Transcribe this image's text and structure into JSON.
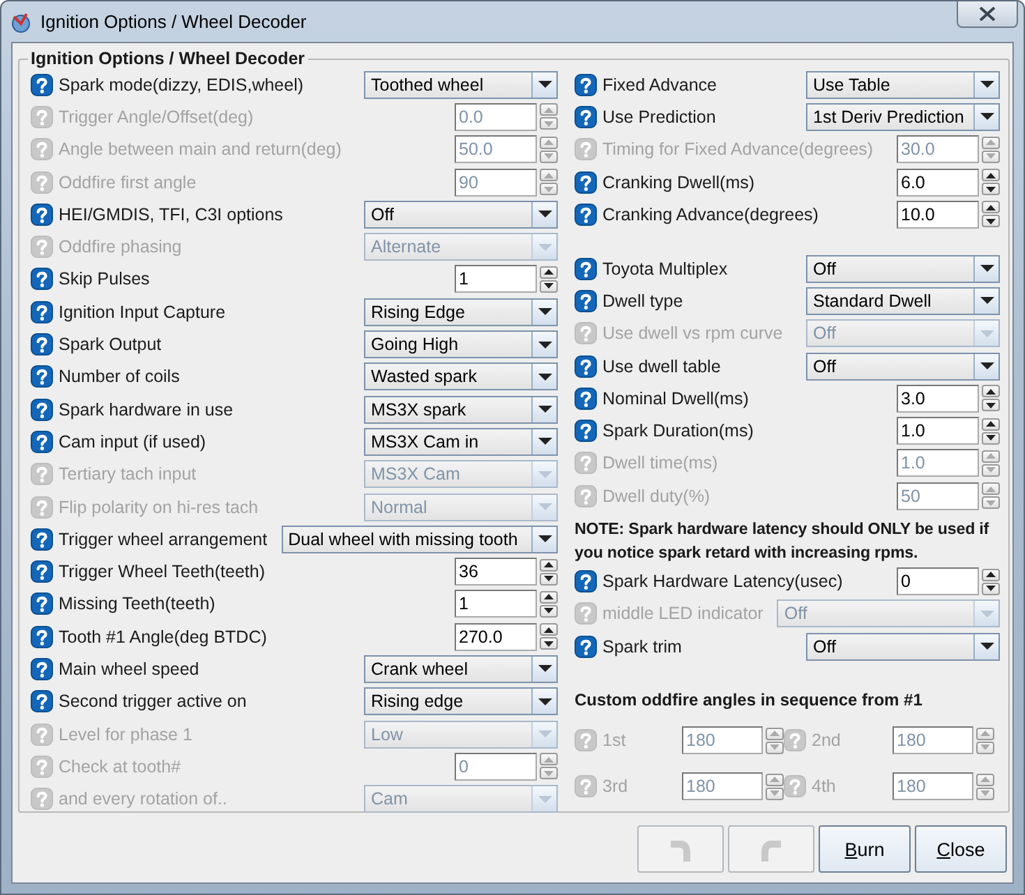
{
  "window": {
    "title": "Ignition Options / Wheel Decoder"
  },
  "panel": {
    "title": "Ignition Options / Wheel Decoder"
  },
  "left_rows": [
    {
      "label": "Spark mode(dizzy, EDIS,wheel)",
      "kind": "combo",
      "value": "Toothed wheel",
      "enabled": true
    },
    {
      "label": "Trigger Angle/Offset(deg)",
      "kind": "spin",
      "value": "0.0",
      "enabled": false
    },
    {
      "label": "Angle between main and return(deg)",
      "kind": "spin",
      "value": "50.0",
      "enabled": false
    },
    {
      "label": "Oddfire first angle",
      "kind": "spin",
      "value": "90",
      "enabled": false
    },
    {
      "label": "HEI/GMDIS, TFI, C3I options",
      "kind": "combo",
      "value": "Off",
      "enabled": true
    },
    {
      "label": "Oddfire phasing",
      "kind": "combo",
      "value": "Alternate",
      "enabled": false
    },
    {
      "label": "Skip Pulses",
      "kind": "spin",
      "value": "1",
      "enabled": true
    },
    {
      "label": "Ignition Input Capture",
      "kind": "combo",
      "value": "Rising Edge",
      "enabled": true
    },
    {
      "label": "Spark Output",
      "kind": "combo",
      "value": "Going High",
      "enabled": true
    },
    {
      "label": "Number of coils",
      "kind": "combo",
      "value": "Wasted spark",
      "enabled": true
    },
    {
      "label": "Spark hardware in use",
      "kind": "combo",
      "value": "MS3X spark",
      "enabled": true
    },
    {
      "label": "Cam input (if used)",
      "kind": "combo",
      "value": "MS3X Cam in",
      "enabled": true
    },
    {
      "label": "Tertiary tach input",
      "kind": "combo",
      "value": "MS3X Cam",
      "enabled": false
    },
    {
      "label": "Flip polarity on hi-res tach",
      "kind": "combo",
      "value": "Normal",
      "enabled": false
    },
    {
      "label": "Trigger wheel arrangement",
      "kind": "wide",
      "value": "Dual wheel with missing tooth",
      "enabled": true
    },
    {
      "label": "Trigger Wheel Teeth(teeth)",
      "kind": "spin",
      "value": "36",
      "enabled": true
    },
    {
      "label": "Missing Teeth(teeth)",
      "kind": "spin",
      "value": "1",
      "enabled": true
    },
    {
      "label": "Tooth #1 Angle(deg BTDC)",
      "kind": "spin",
      "value": "270.0",
      "enabled": true
    },
    {
      "label": "Main wheel speed",
      "kind": "combo",
      "value": "Crank wheel",
      "enabled": true
    },
    {
      "label": "Second trigger active on",
      "kind": "combo",
      "value": "Rising edge",
      "enabled": true
    },
    {
      "label": "Level for phase 1",
      "kind": "combo",
      "value": "Low",
      "enabled": false
    },
    {
      "label": "Check at tooth#",
      "kind": "spin",
      "value": "0",
      "enabled": false
    },
    {
      "label": "and every rotation of..",
      "kind": "combo",
      "value": "Cam",
      "enabled": false
    }
  ],
  "right_top": [
    {
      "label": "Fixed Advance",
      "kind": "combo",
      "value": "Use Table",
      "enabled": true
    },
    {
      "label": "Use Prediction",
      "kind": "combo",
      "value": "1st Deriv Prediction",
      "enabled": true
    },
    {
      "label": "Timing for Fixed Advance(degrees)",
      "kind": "spin",
      "value": "30.0",
      "enabled": false
    },
    {
      "label": "Cranking Dwell(ms)",
      "kind": "spin",
      "value": "6.0",
      "enabled": true
    },
    {
      "label": "Cranking Advance(degrees)",
      "kind": "spin",
      "value": "10.0",
      "enabled": true
    }
  ],
  "right_middle": [
    {
      "label": "Toyota Multiplex",
      "kind": "combo",
      "value": "Off",
      "enabled": true
    },
    {
      "label": "Dwell type",
      "kind": "combo",
      "value": "Standard Dwell",
      "enabled": true
    },
    {
      "label": "Use dwell vs rpm curve",
      "kind": "combo",
      "value": "Off",
      "enabled": false
    },
    {
      "label": "Use dwell table",
      "kind": "combo",
      "value": "Off",
      "enabled": true
    },
    {
      "label": "Nominal Dwell(ms)",
      "kind": "spin",
      "value": "3.0",
      "enabled": true
    },
    {
      "label": "Spark Duration(ms)",
      "kind": "spin",
      "value": "1.0",
      "enabled": true
    },
    {
      "label": "Dwell time(ms)",
      "kind": "spin",
      "value": "1.0",
      "enabled": false
    },
    {
      "label": "Dwell duty(%)",
      "kind": "spin",
      "value": "50",
      "enabled": false
    }
  ],
  "note": "NOTE: Spark hardware latency should ONLY be used if you notice spark retard with increasing rpms.",
  "right_bottom": [
    {
      "label": "Spark Hardware Latency(usec)",
      "kind": "spin",
      "value": "0",
      "enabled": true
    },
    {
      "label": "middle LED indicator",
      "kind": "wide",
      "value": "Off",
      "enabled": false
    },
    {
      "label": "Spark trim",
      "kind": "combo",
      "value": "Off",
      "enabled": true
    }
  ],
  "oddfire": {
    "heading": "Custom oddfire angles in sequence from #1",
    "angles": [
      {
        "label": "1st",
        "value": "180",
        "enabled": false
      },
      {
        "label": "2nd",
        "value": "180",
        "enabled": false
      },
      {
        "label": "3rd",
        "value": "180",
        "enabled": false
      },
      {
        "label": "4th",
        "value": "180",
        "enabled": false
      }
    ]
  },
  "buttons": [
    {
      "kind": "undo",
      "enabled": false
    },
    {
      "kind": "redo",
      "enabled": false
    },
    {
      "kind": "text",
      "label": "Burn",
      "enabled": true
    },
    {
      "kind": "text",
      "label": "Close",
      "enabled": true
    }
  ]
}
